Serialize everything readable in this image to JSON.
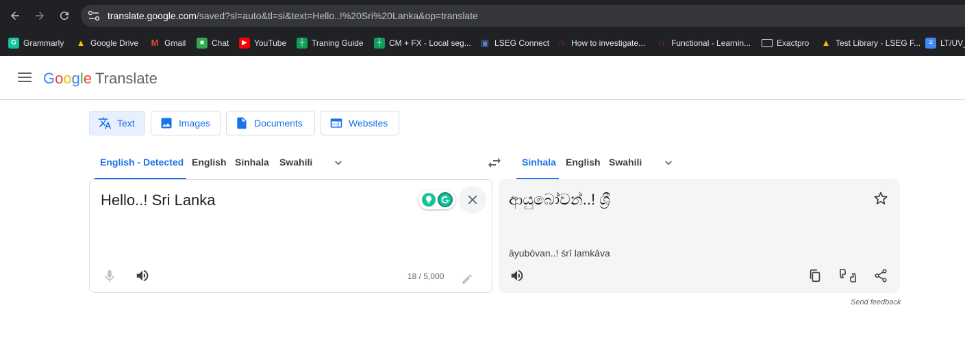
{
  "browser": {
    "url_host": "translate.google.com",
    "url_rest": "/saved?sl=auto&tl=si&text=Hello..!%20Sri%20Lanka&op=translate",
    "bookmarks": [
      {
        "label": "Grammarly",
        "icon": "grammarly-icon",
        "color": "#15c39a"
      },
      {
        "label": "Google Drive",
        "icon": "google-drive-icon",
        "color": "#fbbc05"
      },
      {
        "label": "Gmail",
        "icon": "gmail-icon",
        "color": "#ea4335"
      },
      {
        "label": "Chat",
        "icon": "google-chat-icon",
        "color": "#34a853"
      },
      {
        "label": "YouTube",
        "icon": "youtube-icon",
        "color": "#ff0000"
      },
      {
        "label": "Traning Guide",
        "icon": "sheets-icon",
        "color": "#0f9d58"
      },
      {
        "label": "CM + FX - Local seg...",
        "icon": "sheets-icon",
        "color": "#0f9d58"
      },
      {
        "label": "LSEG Connect",
        "icon": "lock-icon",
        "color": "#5b7cc4"
      },
      {
        "label": "How to investigate...",
        "icon": "headset-icon",
        "color": "#b3261e"
      },
      {
        "label": "Functional - Learnin...",
        "icon": "headset-icon",
        "color": "#b3261e"
      },
      {
        "label": "Exactpro",
        "icon": "folder-icon",
        "color": "#e3e3e3"
      },
      {
        "label": "Test Library - LSEG F...",
        "icon": "google-drive-icon",
        "color": "#fbbc05"
      },
      {
        "label": "LT/UV_",
        "icon": "docs-icon",
        "color": "#4285f4"
      }
    ]
  },
  "header": {
    "logo_letters": [
      "G",
      "o",
      "o",
      "g",
      "l",
      "e"
    ],
    "product": "Translate"
  },
  "modes": [
    {
      "label": "Text",
      "icon": "translate-icon"
    },
    {
      "label": "Images",
      "icon": "image-icon"
    },
    {
      "label": "Documents",
      "icon": "document-icon"
    },
    {
      "label": "Websites",
      "icon": "website-icon"
    }
  ],
  "source_langs": [
    "English - Detected",
    "English",
    "Sinhala",
    "Swahili"
  ],
  "target_langs": [
    "Sinhala",
    "English",
    "Swahili"
  ],
  "source": {
    "text": "Hello..! Sri Lanka",
    "char_count": "18 / 5,000"
  },
  "target": {
    "text": "ආයුබෝවන්..!  ශ්‍රී",
    "romanized": "āyubōvan..! śrī laṁkāva"
  },
  "footer": {
    "feedback": "Send feedback"
  },
  "colors": {
    "accent": "#1a73e8",
    "chrome_bg": "#202124"
  }
}
